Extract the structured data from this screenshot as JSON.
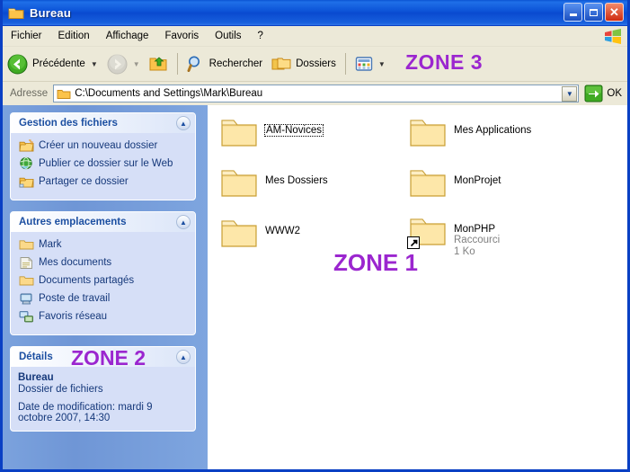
{
  "window": {
    "title": "Bureau",
    "controls": {
      "minimize": "_",
      "maximize": "□",
      "close": "✕"
    }
  },
  "menu": {
    "items": [
      "Fichier",
      "Edition",
      "Affichage",
      "Favoris",
      "Outils",
      "?"
    ]
  },
  "toolbar": {
    "back_label": "Précédente",
    "search_label": "Rechercher",
    "folders_label": "Dossiers",
    "zone_overlay": "ZONE 3"
  },
  "address": {
    "label": "Adresse",
    "value": "C:\\Documents and Settings\\Mark\\Bureau",
    "go_label": "OK"
  },
  "sidebar": {
    "zone_overlay": "ZONE 2",
    "panels": [
      {
        "title": "Gestion des fichiers",
        "items": [
          {
            "label": "Créer un nouveau dossier",
            "icon": "new-folder-icon"
          },
          {
            "label": "Publier ce dossier sur le Web",
            "icon": "globe-icon"
          },
          {
            "label": "Partager ce dossier",
            "icon": "shared-folder-icon"
          }
        ]
      },
      {
        "title": "Autres emplacements",
        "items": [
          {
            "label": "Mark",
            "icon": "folder-icon"
          },
          {
            "label": "Mes documents",
            "icon": "documents-icon"
          },
          {
            "label": "Documents partagés",
            "icon": "folder-icon"
          },
          {
            "label": "Poste de travail",
            "icon": "computer-icon"
          },
          {
            "label": "Favoris réseau",
            "icon": "network-icon"
          }
        ]
      },
      {
        "title": "Détails",
        "name": "Bureau",
        "type": "Dossier de fichiers",
        "modified": "Date de modification: mardi 9 octobre 2007, 14:30"
      }
    ]
  },
  "files": {
    "zone_overlay": "ZONE 1",
    "items": [
      {
        "name": "AM-Novices",
        "sub1": "",
        "sub2": "",
        "focused": true,
        "shortcut": false
      },
      {
        "name": "Mes Applications",
        "sub1": "",
        "sub2": "",
        "focused": false,
        "shortcut": false
      },
      {
        "name": "Mes Dossiers",
        "sub1": "",
        "sub2": "",
        "focused": false,
        "shortcut": false
      },
      {
        "name": "MonProjet",
        "sub1": "",
        "sub2": "",
        "focused": false,
        "shortcut": false
      },
      {
        "name": "WWW2",
        "sub1": "",
        "sub2": "",
        "focused": false,
        "shortcut": false
      },
      {
        "name": "MonPHP",
        "sub1": "Raccourci",
        "sub2": "1 Ko",
        "focused": false,
        "shortcut": true
      }
    ]
  },
  "colors": {
    "accent_purple": "#9b26cf",
    "title_blue": "#0d55d8",
    "sidebar_blue": "#7ba2dd",
    "panel_body": "#d6dff7",
    "chrome_cream": "#ece9d8"
  }
}
